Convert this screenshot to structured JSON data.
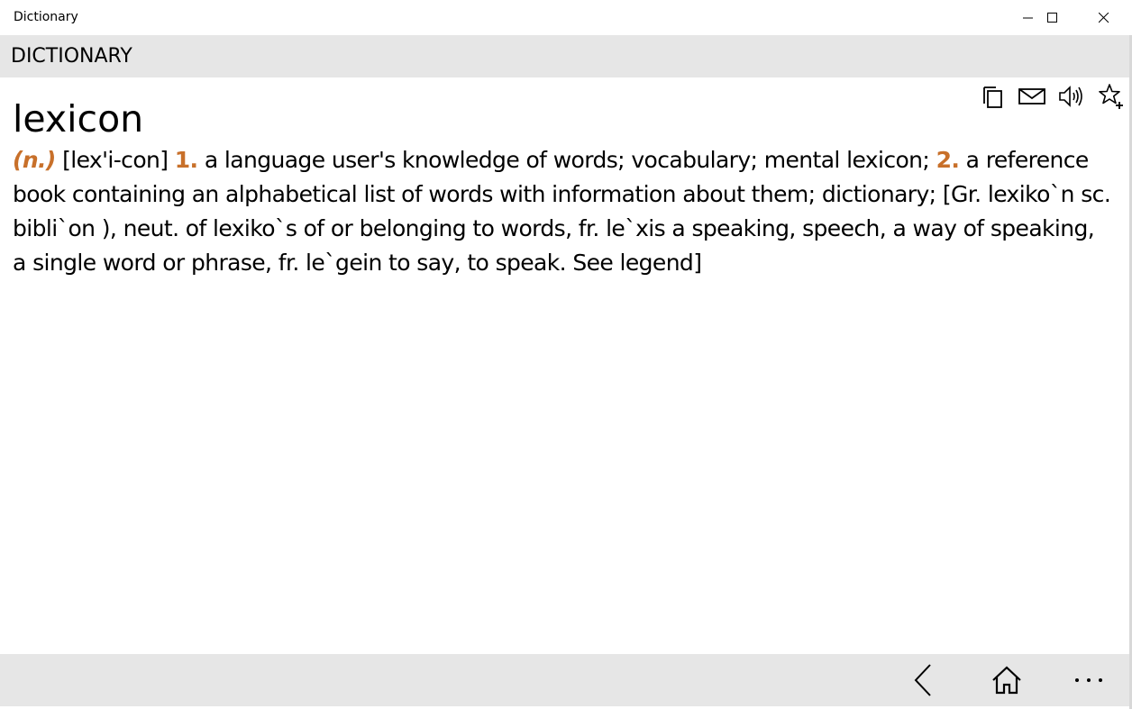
{
  "window": {
    "title": "Dictionary"
  },
  "header": {
    "title": "DICTIONARY"
  },
  "toolbar": {
    "icons": [
      "copy-icon",
      "mail-icon",
      "speaker-icon",
      "star-add-icon"
    ]
  },
  "entry": {
    "headword": "lexicon",
    "pos": "(n.)",
    "pronunciation": " [lex'i-con] ",
    "sense1_number": "1.",
    "sense1_text": " a language user's knowledge of words; vocabulary; mental lexicon; ",
    "sense2_number": "2.",
    "sense2_text": " a reference book containing an alphabetical list of words with information about them; dictionary; [Gr. lexiko`n sc. bibli`on ), neut. of lexiko`s of or belonging to words, fr. le`xis a speaking, speech, a way of speaking, a single word or phrase, fr. le`gein to say, to speak. See legend]"
  },
  "bottom_bar": {
    "icons": [
      "back-icon",
      "home-icon",
      "more-icon"
    ]
  },
  "colors": {
    "accent": "#c8702a",
    "bar_background": "#e6e6e6"
  }
}
